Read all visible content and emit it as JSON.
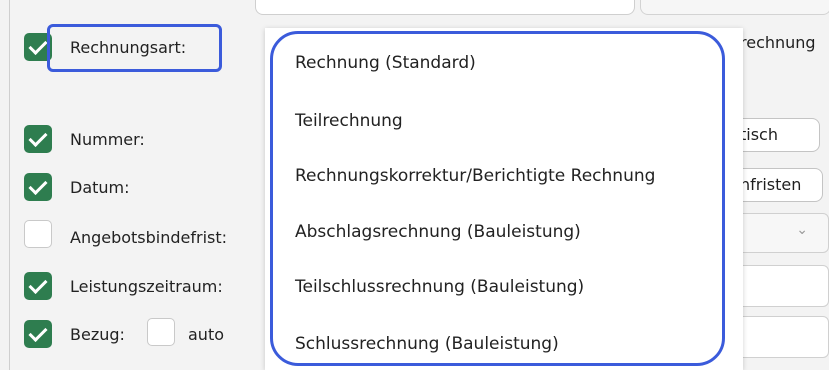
{
  "fields": {
    "rechnungsart": {
      "label": "Rechnungsart:",
      "checked": true
    },
    "nummer": {
      "label": "Nummer:",
      "checked": true
    },
    "datum": {
      "label": "Datum:",
      "checked": true
    },
    "angebotsbindefrist": {
      "label": "Angebotsbindefrist:",
      "checked": false
    },
    "leistungszeitraum": {
      "label": "Leistungszeitraum:",
      "checked": true
    },
    "bezug": {
      "label": "Bezug:",
      "checked": true
    },
    "auto": {
      "label": "auto",
      "checked": false
    }
  },
  "dropdown": {
    "options": [
      "Rechnung (Standard)",
      "Teilrechnung",
      "Rechnungskorrektur/Berichtigte Rechnung",
      "Abschlagsrechnung (Bauleistung)",
      "Teilschlussrechnung (Bauleistung)",
      "Schlussrechnung (Bauleistung)"
    ]
  },
  "right_panel": {
    "partial_text": "rechnung",
    "button1_partial": "tisch",
    "button2_partial": "nfristen",
    "select_chevron_icon": "chevron-down-icon"
  },
  "colors": {
    "checkbox_checked": "#2e7d4f",
    "highlight": "#3b5bdb"
  }
}
